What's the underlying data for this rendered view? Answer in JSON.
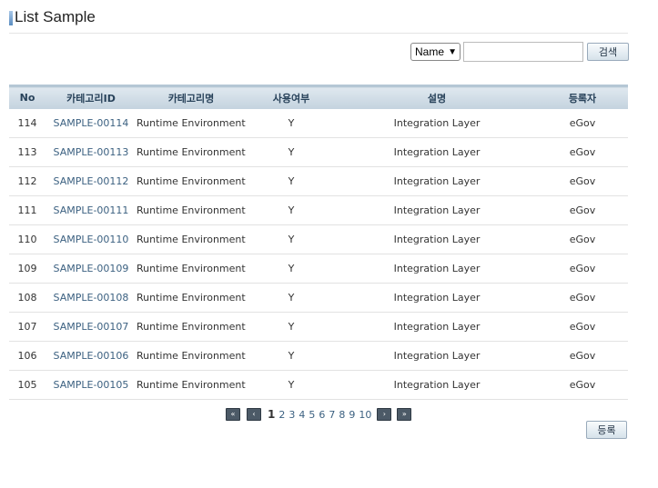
{
  "page": {
    "title": "List Sample"
  },
  "search": {
    "condition_selected": "Name",
    "keyword_value": "",
    "search_button": "검색"
  },
  "table": {
    "columns": [
      "No",
      "카테고리ID",
      "카테고리명",
      "사용여부",
      "설명",
      "등록자"
    ],
    "rows": [
      [
        "114",
        "SAMPLE-00114",
        "Runtime Environment",
        "Y",
        "Integration Layer",
        "eGov"
      ],
      [
        "113",
        "SAMPLE-00113",
        "Runtime Environment",
        "Y",
        "Integration Layer",
        "eGov"
      ],
      [
        "112",
        "SAMPLE-00112",
        "Runtime Environment",
        "Y",
        "Integration Layer",
        "eGov"
      ],
      [
        "111",
        "SAMPLE-00111",
        "Runtime Environment",
        "Y",
        "Integration Layer",
        "eGov"
      ],
      [
        "110",
        "SAMPLE-00110",
        "Runtime Environment",
        "Y",
        "Integration Layer",
        "eGov"
      ],
      [
        "109",
        "SAMPLE-00109",
        "Runtime Environment",
        "Y",
        "Integration Layer",
        "eGov"
      ],
      [
        "108",
        "SAMPLE-00108",
        "Runtime Environment",
        "Y",
        "Integration Layer",
        "eGov"
      ],
      [
        "107",
        "SAMPLE-00107",
        "Runtime Environment",
        "Y",
        "Integration Layer",
        "eGov"
      ],
      [
        "106",
        "SAMPLE-00106",
        "Runtime Environment",
        "Y",
        "Integration Layer",
        "eGov"
      ],
      [
        "105",
        "SAMPLE-00105",
        "Runtime Environment",
        "Y",
        "Integration Layer",
        "eGov"
      ]
    ]
  },
  "pagination": {
    "first_icon": "double-chevron-left-icon",
    "prev_icon": "chevron-left-icon",
    "next_icon": "chevron-right-icon",
    "last_icon": "double-chevron-right-icon",
    "current_page": "1",
    "pages": [
      "1",
      "2",
      "3",
      "4",
      "5",
      "6",
      "7",
      "8",
      "9",
      "10"
    ]
  },
  "actions": {
    "register_button": "등록"
  },
  "colors": {
    "header_bg": "#c3d2de",
    "header_text": "#28425a",
    "link_text": "#3c6181",
    "pager_button": "#4c5a67"
  }
}
